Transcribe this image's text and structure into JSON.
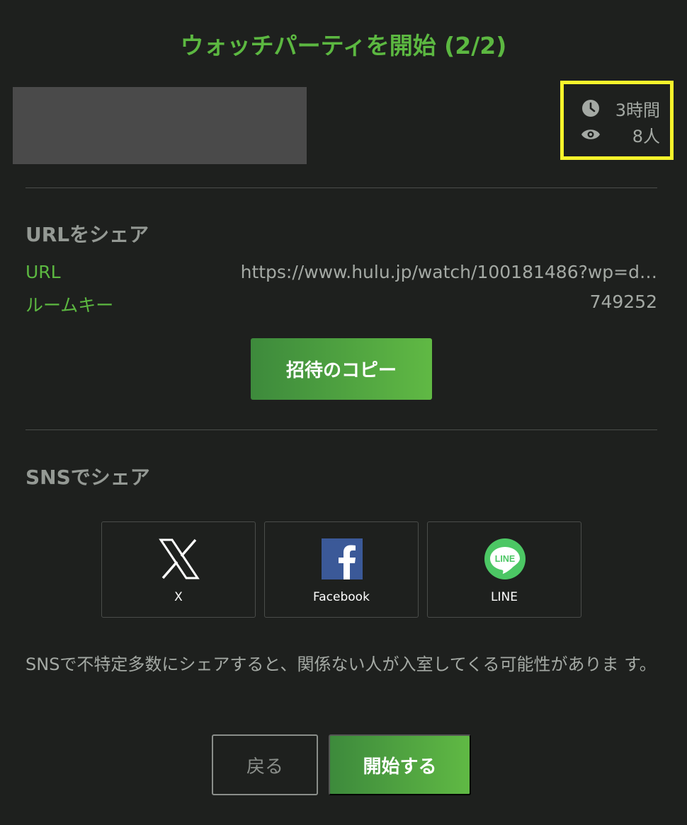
{
  "header": {
    "title": "ウォッチパーティを開始 (2/2)"
  },
  "stats": {
    "duration": "3時間",
    "duration_icon": "clock-icon",
    "viewers": "8人",
    "viewers_icon": "eye-icon",
    "highlight_color": "#f7f42b"
  },
  "share_url": {
    "title": "URLをシェア",
    "url_label": "URL",
    "url_value": "https://www.hulu.jp/watch/100181486?wp=d…",
    "roomkey_label": "ルームキー",
    "roomkey_value": "749252",
    "copy_button": "招待のコピー"
  },
  "share_sns": {
    "title": "SNSでシェア",
    "items": [
      {
        "label": "X",
        "icon": "x-logo-icon"
      },
      {
        "label": "Facebook",
        "icon": "facebook-logo-icon"
      },
      {
        "label": "LINE",
        "icon": "line-logo-icon",
        "logo_text": "LINE"
      }
    ],
    "note": "SNSで不特定多数にシェアすると、関係ない人が入室してくる可能性がありま す。"
  },
  "footer": {
    "back_button": "戻る",
    "start_button": "開始する"
  },
  "colors": {
    "accent": "#5cb841",
    "background": "#1e201e",
    "facebook": "#3b5998",
    "line": "#4cc764"
  }
}
